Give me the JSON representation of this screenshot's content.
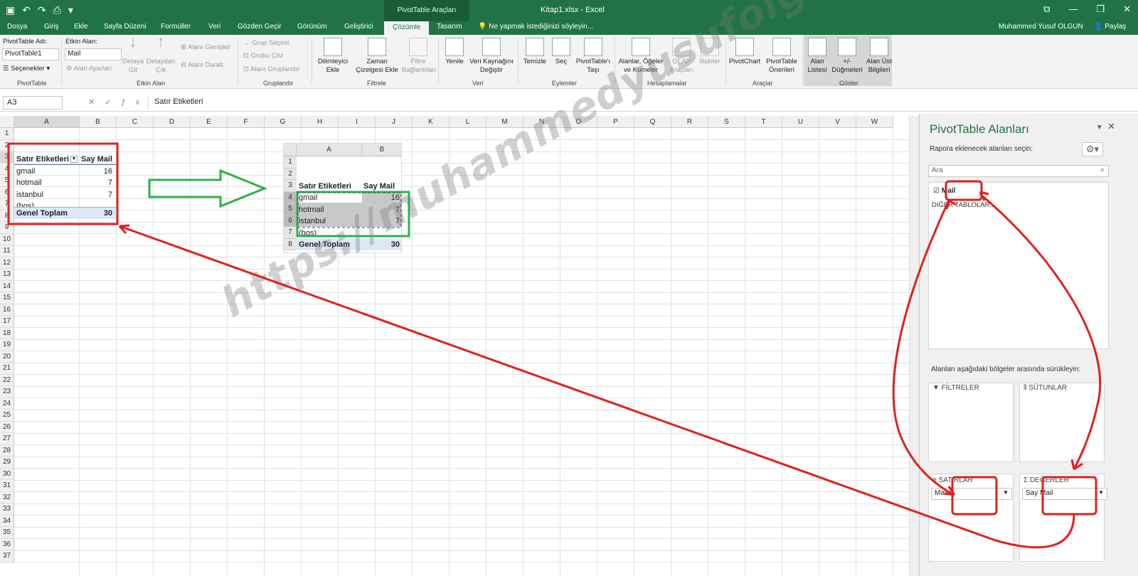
{
  "titlebar": {
    "context_tab": "PivotTable Araçları",
    "doc_title": "Kitap1.xlsx - Excel"
  },
  "menu": {
    "tabs": [
      "Dosya",
      "Giriş",
      "Ekle",
      "Sayfa Düzeni",
      "Formüller",
      "Veri",
      "Gözden Geçir",
      "Görünüm",
      "Geliştirici",
      "Çözümle",
      "Tasarım"
    ],
    "active": "Çözümle",
    "tell_me": "Ne yapmak istediğinizi söyleyin...",
    "user": "Muhammed Yusuf OLGUN",
    "share": "Paylaş"
  },
  "ribbon": {
    "pivot_name_label": "PivotTable Adı:",
    "pivot_name_value": "PivotTable1",
    "options_label": "Seçenekler",
    "group_pivottable": "PivotTable",
    "active_field_label": "Etkin Alan:",
    "active_field_value": "Mail",
    "field_settings": "Alan Ayarları",
    "drill_down": "Detaya Git",
    "drill_up": "Detaydan Çık",
    "expand_field": "Alanı Genişlet",
    "collapse_field": "Alanı Daralt",
    "group_active_field": "Etkin Alan",
    "group_selection": "Grup Seçimi",
    "ungroup": "Grubu Çöz",
    "group_field": "Alanı Gruplandır",
    "group_grouping": "Gruplandır",
    "insert_slicer": "Dilimleyici Ekle",
    "insert_timeline": "Zaman Çizelgesi Ekle",
    "filter_connections": "Filtre Bağlantıları",
    "group_filter": "Filtrele",
    "refresh": "Yenile",
    "change_source": "Veri Kaynağını Değiştir",
    "group_data": "Veri",
    "clear": "Temizle",
    "select": "Seç",
    "move_pivot": "PivotTable'ı Taşı",
    "group_actions": "Eylemler",
    "fields_items": "Alanlar, Öğeler ve Kümeler",
    "olap_tools": "OLAP Araçları",
    "relationships": "İlişkiler",
    "group_calculations": "Hesaplamalar",
    "pivotchart": "PivotChart",
    "recommended": "PivotTable Önerileri",
    "group_tools": "Araçlar",
    "field_list": "Alan Listesi",
    "buttons": "+/- Düğmeleri",
    "field_headers": "Alan Üst Bilgileri",
    "group_show": "Göster"
  },
  "formula_bar": {
    "name_box": "A3",
    "content": "Satır Etiketleri"
  },
  "sheet": {
    "columns": [
      "A",
      "B",
      "C",
      "D",
      "E",
      "F",
      "G",
      "H",
      "I",
      "J",
      "K",
      "L",
      "M",
      "N",
      "O",
      "P",
      "Q",
      "R",
      "S",
      "T",
      "U",
      "V",
      "W"
    ],
    "rows": [
      "1",
      "2",
      "3",
      "4",
      "5",
      "6",
      "7",
      "8",
      "9",
      "10",
      "11",
      "12",
      "13",
      "14",
      "15",
      "16",
      "17",
      "18",
      "19",
      "20",
      "21",
      "22",
      "23",
      "24",
      "25",
      "26",
      "27",
      "28",
      "29",
      "30",
      "31",
      "32",
      "33",
      "34",
      "35",
      "36",
      "37"
    ],
    "pivot": {
      "header_label": "Satır Etiketleri",
      "header_value": "Say Mail",
      "rows": [
        {
          "label": "gmail",
          "value": "16"
        },
        {
          "label": "hotmail",
          "value": "7"
        },
        {
          "label": "istanbul",
          "value": "7"
        },
        {
          "label": "(boş)",
          "value": ""
        }
      ],
      "total_label": "Genel Toplam",
      "total_value": "30"
    }
  },
  "inset": {
    "columns": [
      "A",
      "B"
    ],
    "rows": [
      "1",
      "2",
      "3",
      "4",
      "5",
      "6",
      "7",
      "8"
    ],
    "header_label": "Satır Etiketleri",
    "header_value": "Say Mail",
    "items": [
      {
        "label": "gmail",
        "value": "16"
      },
      {
        "label": "hotmail",
        "value": "7"
      },
      {
        "label": "istanbul",
        "value": "7"
      },
      {
        "label": "(boş)",
        "value": ""
      }
    ],
    "total_label": "Genel Toplam",
    "total_value": "30"
  },
  "panel": {
    "title": "PivotTable Alanları",
    "subtitle": "Rapora eklenecek alanları seçin:",
    "search_placeholder": "Ara",
    "field_mail": "Mail",
    "other_tables": "DİĞER TABLOLAR...",
    "drag_text": "Alanları aşağıdaki bölgeler arasında sürükleyin:",
    "filters": "FİLTRELER",
    "columns": "SÜTUNLAR",
    "rows": "SATIRLAR",
    "values": "DEĞERLER",
    "rows_field": "Mail",
    "values_field": "Say Mail"
  },
  "watermark": "https://muhammedyusufolgun.blogspot.com",
  "colors": {
    "excel_green": "#217346",
    "annot_red": "#e02020",
    "annot_green": "#2bb24c"
  }
}
